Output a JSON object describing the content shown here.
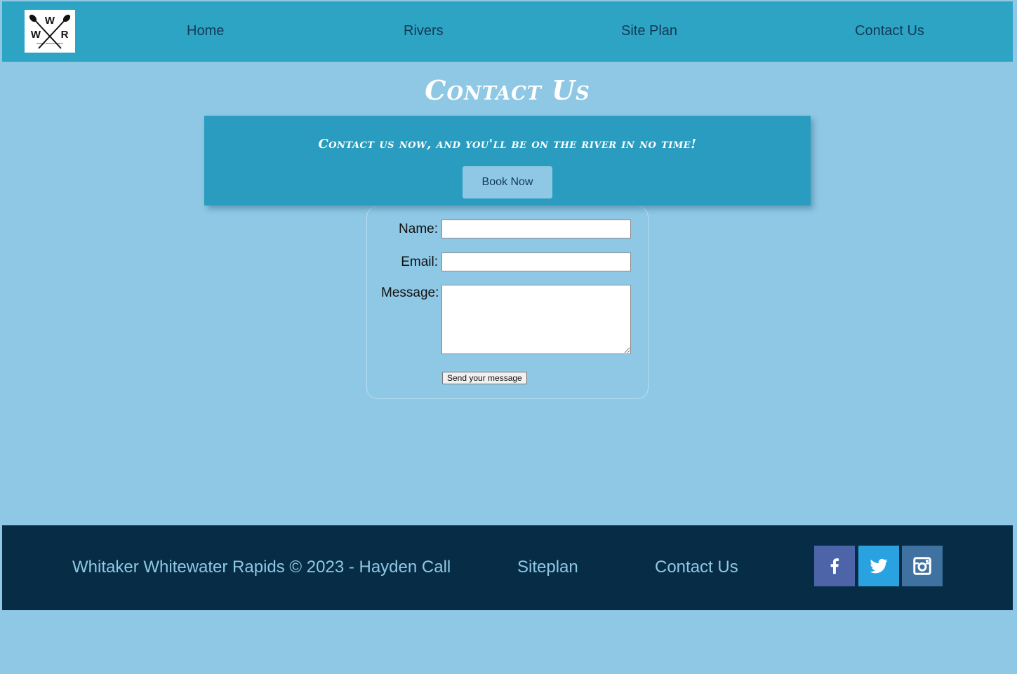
{
  "header": {
    "logo": {
      "letters": [
        "W",
        "W",
        "R"
      ],
      "caption": "Whitaker Whitewater Rapids"
    },
    "nav": [
      {
        "label": "Home"
      },
      {
        "label": "Rivers"
      },
      {
        "label": "Site Plan"
      },
      {
        "label": "Contact Us"
      }
    ]
  },
  "main": {
    "title": "Contact Us",
    "banner": {
      "text": "Contact us now, and you'll be on the river in no time!",
      "button": "Book Now"
    },
    "form": {
      "name_label": "Name:",
      "name_value": "",
      "email_label": "Email:",
      "email_value": "",
      "message_label": "Message:",
      "message_value": "",
      "submit_label": "Send your message"
    }
  },
  "footer": {
    "copyright": "Whitaker Whitewater Rapids © 2023 - Hayden Call",
    "links": [
      {
        "label": "Siteplan"
      },
      {
        "label": "Contact Us"
      }
    ],
    "social": [
      {
        "icon": "facebook-icon",
        "color": "#4d65a8"
      },
      {
        "icon": "twitter-icon",
        "color": "#2aa2df"
      },
      {
        "icon": "instagram-icon",
        "color": "#3f72a0"
      }
    ]
  },
  "colors": {
    "page_bg": "#8fc8e5",
    "header_bg": "#2ea4c4",
    "banner_bg": "#2a9cbf",
    "footer_bg": "#072c46",
    "nav_text": "#123a57"
  }
}
